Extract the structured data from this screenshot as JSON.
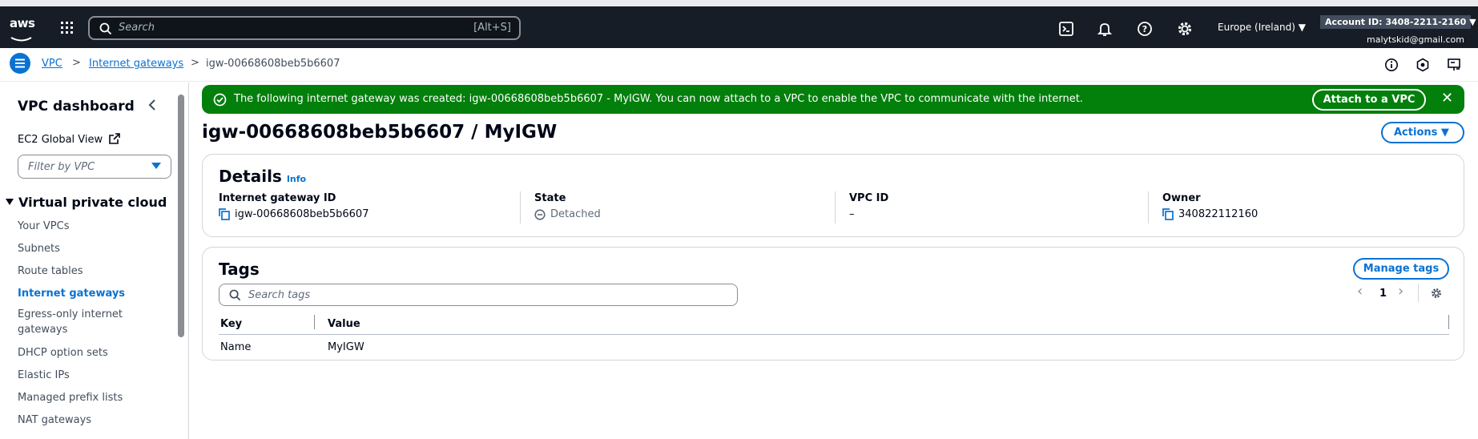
{
  "topbar": {
    "logo": "aws",
    "search_placeholder": "Search",
    "search_shortcut": "[Alt+S]",
    "region": "Europe (Ireland) ▼",
    "account": "Account ID: 3408-2211-2160 ▼",
    "email": "malytskid@gmail.com",
    "icons": [
      "cloudshell-icon",
      "bell-icon",
      "help-icon",
      "gear-icon"
    ]
  },
  "breadcrumb": {
    "items": [
      "VPC",
      "Internet gateways",
      "igw-00668608beb5b6607"
    ],
    "separator": ">"
  },
  "sidebar": {
    "title": "VPC dashboard",
    "global_view": "EC2 Global View",
    "filter_placeholder": "Filter by VPC",
    "section": "Virtual private cloud",
    "items": [
      "Your VPCs",
      "Subnets",
      "Route tables",
      "Internet gateways",
      "Egress-only internet",
      "gateways",
      "DHCP option sets",
      "Elastic IPs",
      "Managed prefix lists",
      "NAT gateways"
    ],
    "active_index": 3
  },
  "flash": {
    "message": "The following internet gateway was created: igw-00668608beb5b6607 - MyIGW. You can now attach to a VPC to enable the VPC to communicate with the internet.",
    "action": "Attach to a VPC",
    "close": "✕"
  },
  "page": {
    "title": "igw-00668608beb5b6607 / MyIGW",
    "actions": "Actions ▼"
  },
  "details": {
    "title": "Details",
    "info": "Info",
    "fields": [
      {
        "label": "Internet gateway ID",
        "value": "igw-00668608beb5b6607"
      },
      {
        "label": "State",
        "value": "Detached"
      },
      {
        "label": "VPC ID",
        "value": "–"
      },
      {
        "label": "Owner",
        "value": "340822112160"
      }
    ]
  },
  "tags": {
    "title": "Tags",
    "manage": "Manage tags",
    "search_placeholder": "Search tags",
    "page": "1",
    "prev": "‹",
    "next": "›",
    "headers": [
      "Key",
      "Value"
    ],
    "rows": [
      [
        "Name",
        "MyIGW"
      ]
    ]
  },
  "colors": {
    "topbar": "#161d26",
    "link": "#0972d3",
    "success": "#037f0c"
  }
}
